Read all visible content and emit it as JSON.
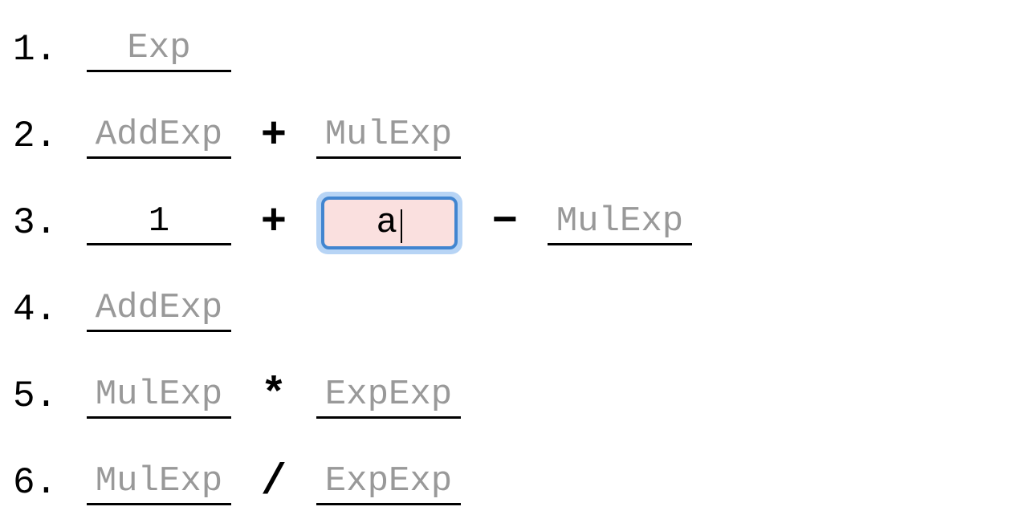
{
  "rows": [
    {
      "num": "1.",
      "items": [
        {
          "type": "slot",
          "kind": "placeholder",
          "text": "Exp"
        }
      ]
    },
    {
      "num": "2.",
      "items": [
        {
          "type": "slot",
          "kind": "placeholder",
          "text": "AddExp"
        },
        {
          "type": "op",
          "text": "+"
        },
        {
          "type": "slot",
          "kind": "placeholder",
          "text": "MulExp"
        }
      ]
    },
    {
      "num": "3.",
      "items": [
        {
          "type": "slot",
          "kind": "value",
          "text": "1"
        },
        {
          "type": "op",
          "text": "+"
        },
        {
          "type": "active",
          "text": "a"
        },
        {
          "type": "op",
          "text": "−"
        },
        {
          "type": "slot",
          "kind": "placeholder",
          "text": "MulExp"
        }
      ]
    },
    {
      "num": "4.",
      "items": [
        {
          "type": "slot",
          "kind": "placeholder",
          "text": "AddExp"
        }
      ]
    },
    {
      "num": "5.",
      "items": [
        {
          "type": "slot",
          "kind": "placeholder",
          "text": "MulExp"
        },
        {
          "type": "op",
          "text": "*"
        },
        {
          "type": "slot",
          "kind": "placeholder",
          "text": "ExpExp"
        }
      ]
    },
    {
      "num": "6.",
      "items": [
        {
          "type": "slot",
          "kind": "placeholder",
          "text": "MulExp"
        },
        {
          "type": "op",
          "text": "/"
        },
        {
          "type": "slot",
          "kind": "placeholder",
          "text": "ExpExp"
        }
      ]
    }
  ]
}
